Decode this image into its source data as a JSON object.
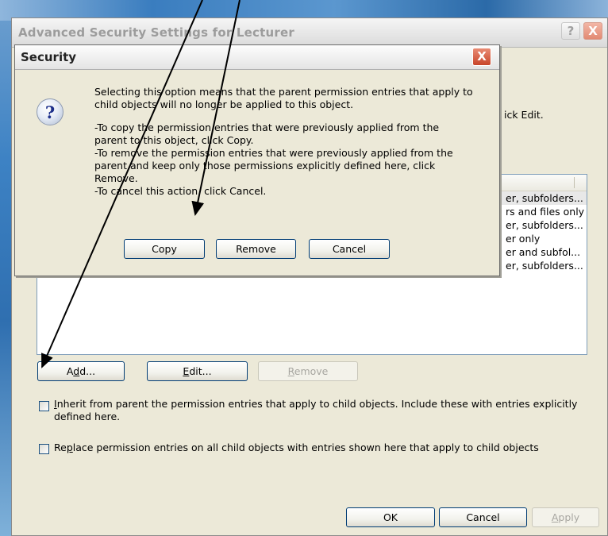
{
  "main_window": {
    "title": "Advanced Security Settings for Lecturer",
    "help_glyph": "?",
    "close_glyph": "X",
    "behind_text": "ick Edit.",
    "permission_rows": [
      {
        "apply_to": "er, subfolders..."
      },
      {
        "apply_to": "rs and files only"
      },
      {
        "apply_to": "er, subfolders..."
      },
      {
        "apply_to": "er only"
      },
      {
        "apply_to": "er and subfol..."
      },
      {
        "apply_to": "er, subfolders..."
      }
    ],
    "buttons": {
      "add": {
        "pre": "A",
        "ul": "d",
        "post": "d..."
      },
      "edit": {
        "pre": "",
        "ul": "E",
        "post": "dit..."
      },
      "remove": {
        "pre": "",
        "ul": "R",
        "post": "emove"
      },
      "ok": "OK",
      "cancel": "Cancel",
      "apply": {
        "pre": "",
        "ul": "A",
        "post": "pply"
      }
    },
    "inherit_checkbox": {
      "checked": false,
      "ul": "I",
      "label": "nherit from parent the permission entries that apply to child objects. Include these with entries explicitly defined here."
    },
    "replace_checkbox": {
      "checked": false,
      "pre": "Re",
      "ul": "p",
      "label": "lace permission entries on all child objects with entries shown here that apply to child objects"
    }
  },
  "security_dialog": {
    "title": "Security",
    "close_glyph": "X",
    "icon": "question-icon",
    "icon_glyph": "?",
    "message_lines": [
      "Selecting this option means that the parent permission entries that apply to",
      "child objects will no longer be applied to this object."
    ],
    "instructions": [
      "-To copy  the permission entries that were previously applied from the",
      "parent to this object, click Copy.",
      "-To remove the permission entries that were previously applied from the",
      "parent and keep only those permissions explicitly defined here, click",
      "Remove.",
      "-To cancel this action, click Cancel."
    ],
    "buttons": {
      "copy": "Copy",
      "remove": "Remove",
      "cancel": "Cancel"
    }
  },
  "colors": {
    "window_face": "#ece9d8",
    "button_border": "#003c74",
    "close_red": "#c8452a",
    "arrow": "#000000"
  }
}
